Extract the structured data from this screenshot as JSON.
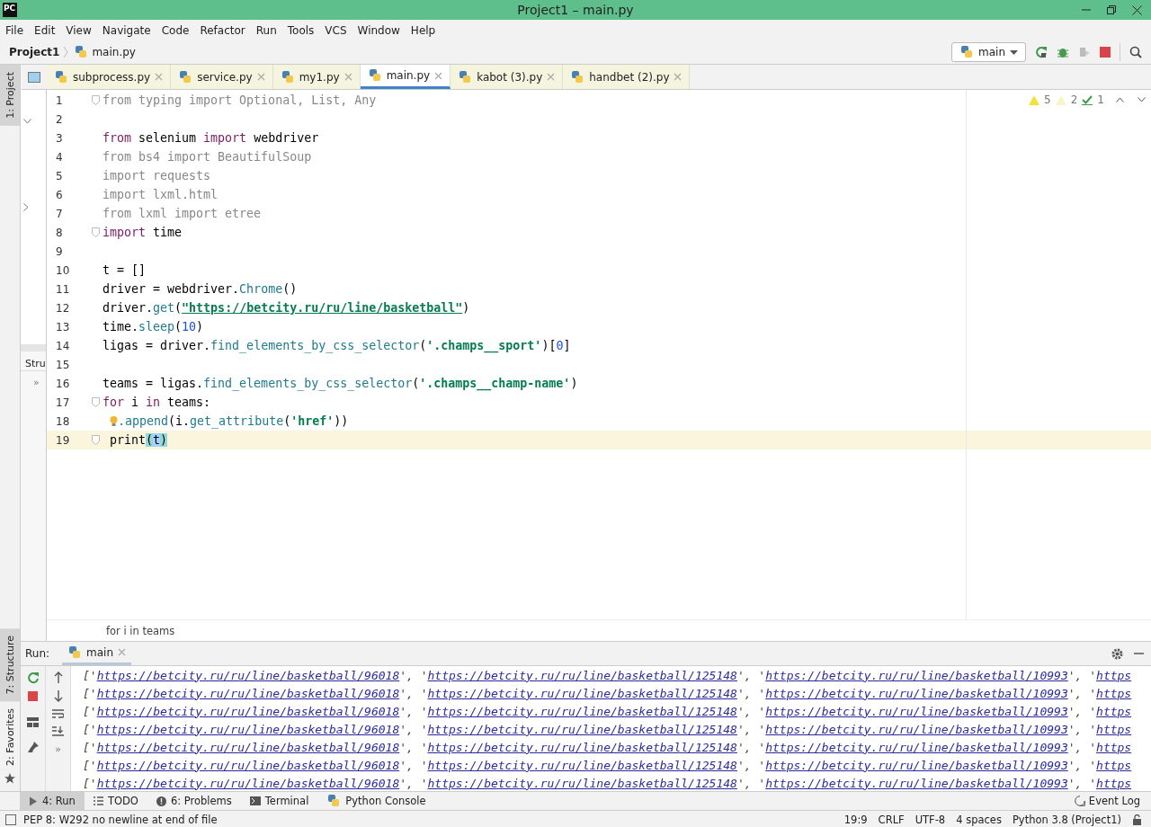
{
  "window": {
    "logo": "PC",
    "title": "Project1 – main.py"
  },
  "menu": [
    "File",
    "Edit",
    "View",
    "Navigate",
    "Code",
    "Refactor",
    "Run",
    "Tools",
    "VCS",
    "Window",
    "Help"
  ],
  "breadcrumb": [
    "Project1",
    "main.py"
  ],
  "run_config": "main",
  "left_tool_tabs_top": [
    {
      "label": "1: Project",
      "selected": true
    }
  ],
  "left_tool_tabs_bottom": [
    {
      "label": "7: Structure",
      "selected": true
    },
    {
      "label": "2: Favorites",
      "selected": false
    }
  ],
  "structure_panel": {
    "title": "Stru",
    "more": "»"
  },
  "tabs": [
    {
      "label": "subprocess.py",
      "selected": false
    },
    {
      "label": "service.py",
      "selected": false
    },
    {
      "label": "my1.py",
      "selected": false
    },
    {
      "label": "main.py",
      "selected": true
    },
    {
      "label": "kabot (3).py",
      "selected": false
    },
    {
      "label": "handbet (2).py",
      "selected": false
    }
  ],
  "inspections": {
    "warnings": "5",
    "weak_warnings": "2",
    "typos": "1"
  },
  "code": [
    {
      "number": "1",
      "fold": true,
      "current": false,
      "tokens": [
        {
          "kind": "dim",
          "text": "from typing import Optional, List, Any"
        }
      ]
    },
    {
      "number": "2",
      "fold": false,
      "current": false
    },
    {
      "number": "3",
      "fold": false,
      "current": false,
      "tokens": [
        {
          "kind": "kw",
          "text": "from"
        },
        {
          "kind": "plain",
          "text": " selenium "
        },
        {
          "kind": "kw",
          "text": "import"
        },
        {
          "kind": "plain",
          "text": " webdriver"
        }
      ]
    },
    {
      "number": "4",
      "fold": false,
      "current": false,
      "tokens": [
        {
          "kind": "dim",
          "text": "from bs4 import BeautifulSoup"
        }
      ]
    },
    {
      "number": "5",
      "fold": false,
      "current": false,
      "tokens": [
        {
          "kind": "dim",
          "text": "import requests"
        }
      ]
    },
    {
      "number": "6",
      "fold": false,
      "current": false,
      "tokens": [
        {
          "kind": "dim",
          "text": "import lxml.html"
        }
      ]
    },
    {
      "number": "7",
      "fold": false,
      "current": false,
      "tokens": [
        {
          "kind": "dim",
          "text": "from lxml import etree"
        }
      ]
    },
    {
      "number": "8",
      "fold": true,
      "current": false,
      "tokens": [
        {
          "kind": "kw",
          "text": "import"
        },
        {
          "kind": "plain",
          "text": " time"
        }
      ]
    },
    {
      "number": "9",
      "fold": false,
      "current": false
    },
    {
      "number": "10",
      "fold": false,
      "current": false,
      "tokens": [
        {
          "kind": "plain",
          "text": "t = []"
        }
      ]
    },
    {
      "number": "11",
      "fold": false,
      "current": false,
      "tokens": [
        {
          "kind": "plain",
          "text": "driver = webdriver."
        },
        {
          "kind": "fn",
          "text": "Chrome"
        },
        {
          "kind": "plain",
          "text": "()"
        }
      ]
    },
    {
      "number": "12",
      "fold": false,
      "current": false,
      "tokens": [
        {
          "kind": "plain",
          "text": "driver."
        },
        {
          "kind": "fn",
          "text": "get"
        },
        {
          "kind": "plain",
          "text": "("
        },
        {
          "kind": "url",
          "text": "\"https://betcity.ru/ru/line/basketball\""
        },
        {
          "kind": "plain",
          "text": ")"
        }
      ]
    },
    {
      "number": "13",
      "fold": false,
      "current": false,
      "tokens": [
        {
          "kind": "plain",
          "text": "time."
        },
        {
          "kind": "fn",
          "text": "sleep"
        },
        {
          "kind": "plain",
          "text": "("
        },
        {
          "kind": "num",
          "text": "10"
        },
        {
          "kind": "plain",
          "text": ")"
        }
      ]
    },
    {
      "number": "14",
      "fold": false,
      "current": false,
      "tokens": [
        {
          "kind": "plain",
          "text": "ligas = driver."
        },
        {
          "kind": "fn",
          "text": "find_elements_by_css_selector"
        },
        {
          "kind": "plain",
          "text": "("
        },
        {
          "kind": "str",
          "text": "'.champs__sport'"
        },
        {
          "kind": "plain",
          "text": ")["
        },
        {
          "kind": "num",
          "text": "0"
        },
        {
          "kind": "plain",
          "text": "]"
        }
      ]
    },
    {
      "number": "15",
      "fold": false,
      "current": false
    },
    {
      "number": "16",
      "fold": false,
      "current": false,
      "tokens": [
        {
          "kind": "plain",
          "text": "teams = ligas."
        },
        {
          "kind": "fn",
          "text": "find_elements_by_css_selector"
        },
        {
          "kind": "plain",
          "text": "("
        },
        {
          "kind": "str",
          "text": "'.champs__champ-name'"
        },
        {
          "kind": "plain",
          "text": ")"
        }
      ]
    },
    {
      "number": "17",
      "fold": true,
      "current": false,
      "tokens": [
        {
          "kind": "kw",
          "text": "for"
        },
        {
          "kind": "plain",
          "text": " i "
        },
        {
          "kind": "kw",
          "text": "in"
        },
        {
          "kind": "plain",
          "text": " teams:"
        }
      ]
    },
    {
      "number": "18",
      "fold": false,
      "current": false,
      "tokens": [
        {
          "kind": "bulb"
        },
        {
          "kind": "fn",
          "text": ".append"
        },
        {
          "kind": "plain",
          "text": "(i."
        },
        {
          "kind": "fn",
          "text": "get_attribute"
        },
        {
          "kind": "plain",
          "text": "("
        },
        {
          "kind": "str",
          "text": "'href'"
        },
        {
          "kind": "plain",
          "text": "))"
        }
      ]
    },
    {
      "number": "19",
      "fold": true,
      "current": true,
      "tokens": [
        {
          "kind": "plain",
          "text": " print"
        },
        {
          "kind": "match",
          "text": "("
        },
        {
          "kind": "sel",
          "text": "t"
        },
        {
          "kind": "match",
          "text": ")"
        }
      ]
    }
  ],
  "editor_breadcrumb": "for i in teams",
  "run_panel": {
    "title": "Run:",
    "tab": "main",
    "more": "»",
    "output": [
      [
        {
          "kind": "punct",
          "text": "['"
        },
        {
          "kind": "link",
          "text": "https://betcity.ru/ru/line/basketball/96018"
        },
        {
          "kind": "punct",
          "text": "', '"
        },
        {
          "kind": "link",
          "text": "https://betcity.ru/ru/line/basketball/125148"
        },
        {
          "kind": "punct",
          "text": "', '"
        },
        {
          "kind": "link",
          "text": "https://betcity.ru/ru/line/basketball/10993"
        },
        {
          "kind": "punct",
          "text": "', '"
        },
        {
          "kind": "link",
          "text": "https"
        }
      ],
      [
        {
          "kind": "punct",
          "text": "['"
        },
        {
          "kind": "link",
          "text": "https://betcity.ru/ru/line/basketball/96018"
        },
        {
          "kind": "punct",
          "text": "', '"
        },
        {
          "kind": "link",
          "text": "https://betcity.ru/ru/line/basketball/125148"
        },
        {
          "kind": "punct",
          "text": "', '"
        },
        {
          "kind": "link",
          "text": "https://betcity.ru/ru/line/basketball/10993"
        },
        {
          "kind": "punct",
          "text": "', '"
        },
        {
          "kind": "link",
          "text": "https"
        }
      ],
      [
        {
          "kind": "punct",
          "text": "['"
        },
        {
          "kind": "link",
          "text": "https://betcity.ru/ru/line/basketball/96018"
        },
        {
          "kind": "punct",
          "text": "', '"
        },
        {
          "kind": "link",
          "text": "https://betcity.ru/ru/line/basketball/125148"
        },
        {
          "kind": "punct",
          "text": "', '"
        },
        {
          "kind": "link",
          "text": "https://betcity.ru/ru/line/basketball/10993"
        },
        {
          "kind": "punct",
          "text": "', '"
        },
        {
          "kind": "link",
          "text": "https"
        }
      ],
      [
        {
          "kind": "punct",
          "text": "['"
        },
        {
          "kind": "link",
          "text": "https://betcity.ru/ru/line/basketball/96018"
        },
        {
          "kind": "punct",
          "text": "', '"
        },
        {
          "kind": "link",
          "text": "https://betcity.ru/ru/line/basketball/125148"
        },
        {
          "kind": "punct",
          "text": "', '"
        },
        {
          "kind": "link",
          "text": "https://betcity.ru/ru/line/basketball/10993"
        },
        {
          "kind": "punct",
          "text": "', '"
        },
        {
          "kind": "link",
          "text": "https"
        }
      ],
      [
        {
          "kind": "punct",
          "text": "['"
        },
        {
          "kind": "link",
          "text": "https://betcity.ru/ru/line/basketball/96018"
        },
        {
          "kind": "punct",
          "text": "', '"
        },
        {
          "kind": "link",
          "text": "https://betcity.ru/ru/line/basketball/125148"
        },
        {
          "kind": "punct",
          "text": "', '"
        },
        {
          "kind": "link",
          "text": "https://betcity.ru/ru/line/basketball/10993"
        },
        {
          "kind": "punct",
          "text": "', '"
        },
        {
          "kind": "link",
          "text": "https"
        }
      ],
      [
        {
          "kind": "punct",
          "text": "['"
        },
        {
          "kind": "link",
          "text": "https://betcity.ru/ru/line/basketball/96018"
        },
        {
          "kind": "punct",
          "text": "', '"
        },
        {
          "kind": "link",
          "text": "https://betcity.ru/ru/line/basketball/125148"
        },
        {
          "kind": "punct",
          "text": "', '"
        },
        {
          "kind": "link",
          "text": "https://betcity.ru/ru/line/basketball/10993"
        },
        {
          "kind": "punct",
          "text": "', '"
        },
        {
          "kind": "link",
          "text": "https"
        }
      ],
      [
        {
          "kind": "punct",
          "text": "['"
        },
        {
          "kind": "link",
          "text": "https://betcity.ru/ru/line/basketball/96018"
        },
        {
          "kind": "punct",
          "text": "', '"
        },
        {
          "kind": "link",
          "text": "https://betcity.ru/ru/line/basketball/125148"
        },
        {
          "kind": "punct",
          "text": "', '"
        },
        {
          "kind": "link",
          "text": "https://betcity.ru/ru/line/basketball/10993"
        },
        {
          "kind": "punct",
          "text": "', '"
        },
        {
          "kind": "link",
          "text": "https"
        }
      ]
    ]
  },
  "bottom_tabs": [
    {
      "label": "4: Run",
      "kind": "run",
      "selected": true
    },
    {
      "label": "TODO",
      "kind": "todo",
      "selected": false
    },
    {
      "label": "6: Problems",
      "kind": "problems",
      "selected": false
    },
    {
      "label": "Terminal",
      "kind": "terminal",
      "selected": false
    },
    {
      "label": "Python Console",
      "kind": "console",
      "selected": false
    }
  ],
  "event_log": "Event Log",
  "status_bar": {
    "message": "PEP 8: W292 no newline at end of file",
    "items": [
      "19:9",
      "CRLF",
      "UTF-8",
      "4 spaces",
      "Python 3.8 (Project1)"
    ]
  }
}
